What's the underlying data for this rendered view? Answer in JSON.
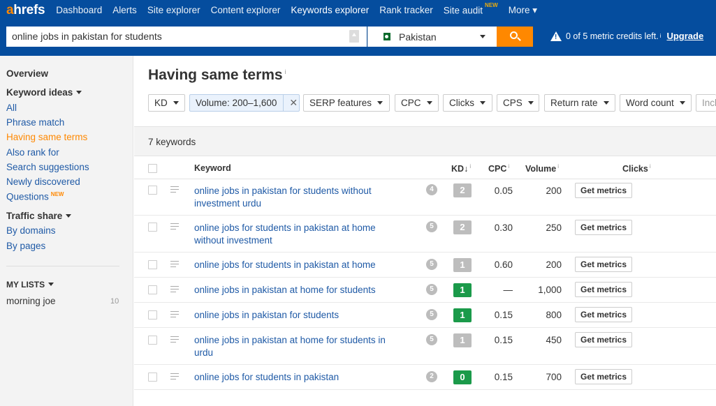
{
  "logo": {
    "a": "a",
    "rest": "hrefs"
  },
  "nav": [
    {
      "label": "Dashboard"
    },
    {
      "label": "Alerts"
    },
    {
      "label": "Site explorer"
    },
    {
      "label": "Content explorer"
    },
    {
      "label": "Keywords explorer",
      "active": true
    },
    {
      "label": "Rank tracker"
    },
    {
      "label": "Site audit",
      "badge": "NEW"
    },
    {
      "label": "More ▾"
    }
  ],
  "search": {
    "query": "online jobs in pakistan for students",
    "country": "Pakistan",
    "credits": "0 of 5 metric credits left.",
    "credits_info": "i",
    "upgrade": "Upgrade"
  },
  "sidebar": {
    "overview": "Overview",
    "keyword_ideas": "Keyword ideas",
    "items": [
      {
        "label": "All"
      },
      {
        "label": "Phrase match"
      },
      {
        "label": "Having same terms"
      },
      {
        "label": "Also rank for"
      },
      {
        "label": "Search suggestions"
      },
      {
        "label": "Newly discovered"
      },
      {
        "label": "Questions",
        "badge": "NEW"
      }
    ],
    "traffic_share": "Traffic share",
    "traffic_items": [
      {
        "label": "By domains"
      },
      {
        "label": "By pages"
      }
    ],
    "my_lists": "MY LISTS",
    "lists": [
      {
        "label": "morning joe",
        "count": "10"
      }
    ]
  },
  "page": {
    "title": "Having same terms",
    "title_info": "i",
    "count_label": "7 keywords"
  },
  "filters": [
    {
      "label": "KD"
    },
    {
      "label": "Volume: 200–1,600",
      "remove": "✕"
    },
    {
      "label": "SERP features"
    },
    {
      "label": "CPC"
    },
    {
      "label": "Clicks"
    },
    {
      "label": "CPS"
    },
    {
      "label": "Return rate"
    },
    {
      "label": "Word count"
    },
    {
      "label": "Incl"
    }
  ],
  "columns": {
    "keyword": "Keyword",
    "kd": "KD",
    "kd_sort": "↓",
    "cpc": "CPC",
    "volume": "Volume",
    "clicks": "Clicks",
    "info": "i"
  },
  "rows": [
    {
      "keyword": "online jobs in pakistan for students without investment urdu",
      "serp": "4",
      "kd": "2",
      "kd_color": "#bdbdbd",
      "cpc": "0.05",
      "volume": "200",
      "action": "Get metrics"
    },
    {
      "keyword": "online jobs for students in pakistan at home without investment",
      "serp": "5",
      "kd": "2",
      "kd_color": "#bdbdbd",
      "cpc": "0.30",
      "volume": "250",
      "action": "Get metrics"
    },
    {
      "keyword": "online jobs for students in pakistan at home",
      "serp": "5",
      "kd": "1",
      "kd_color": "#bdbdbd",
      "cpc": "0.60",
      "volume": "200",
      "action": "Get metrics"
    },
    {
      "keyword": "online jobs in pakistan at home for students",
      "serp": "5",
      "kd": "1",
      "kd_color": "#1b9a4a",
      "cpc": "—",
      "volume": "1,000",
      "action": "Get metrics"
    },
    {
      "keyword": "online jobs in pakistan for students",
      "serp": "5",
      "kd": "1",
      "kd_color": "#1b9a4a",
      "cpc": "0.15",
      "volume": "800",
      "action": "Get metrics"
    },
    {
      "keyword": "online jobs in pakistan at home for students in urdu",
      "serp": "5",
      "kd": "1",
      "kd_color": "#bdbdbd",
      "cpc": "0.15",
      "volume": "450",
      "action": "Get metrics"
    },
    {
      "keyword": "online jobs for students in pakistan",
      "serp": "2",
      "kd": "0",
      "kd_color": "#1b9a4a",
      "cpc": "0.15",
      "volume": "700",
      "action": "Get metrics"
    }
  ]
}
